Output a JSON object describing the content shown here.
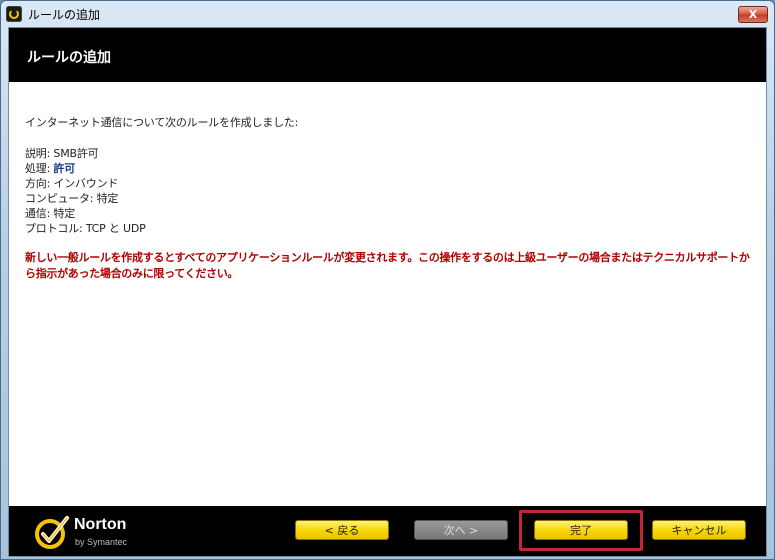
{
  "window": {
    "title": "ルールの追加",
    "close_label": "X"
  },
  "header": {
    "title": "ルールの追加"
  },
  "content": {
    "intro": "インターネット通信について次のルールを作成しました:",
    "details": [
      {
        "label": "説明: ",
        "value": "SMB許可"
      },
      {
        "label": "処理: ",
        "value": "許可"
      },
      {
        "label": "方向: ",
        "value": "インバウンド"
      },
      {
        "label": "コンピュータ: ",
        "value": "特定"
      },
      {
        "label": "通信: ",
        "value": "特定"
      },
      {
        "label": "プロトコル: ",
        "value": "TCP と UDP"
      }
    ],
    "warning": "新しい一般ルールを作成するとすべてのアプリケーションルールが変更されます。この操作をするのは上級ユーザーの場合またはテクニカルサポートから指示があった場合のみに限ってください。"
  },
  "footer": {
    "brand": "Norton",
    "brand_sub": "by Symantec",
    "back_label": "< 戻る",
    "next_label": "次へ >",
    "finish_label": "完了",
    "cancel_label": "キャンセル"
  },
  "colors": {
    "header_bg": "#000000",
    "warning": "#b00000",
    "button_yellow": "#f6d400",
    "highlight": "#c0283a"
  }
}
